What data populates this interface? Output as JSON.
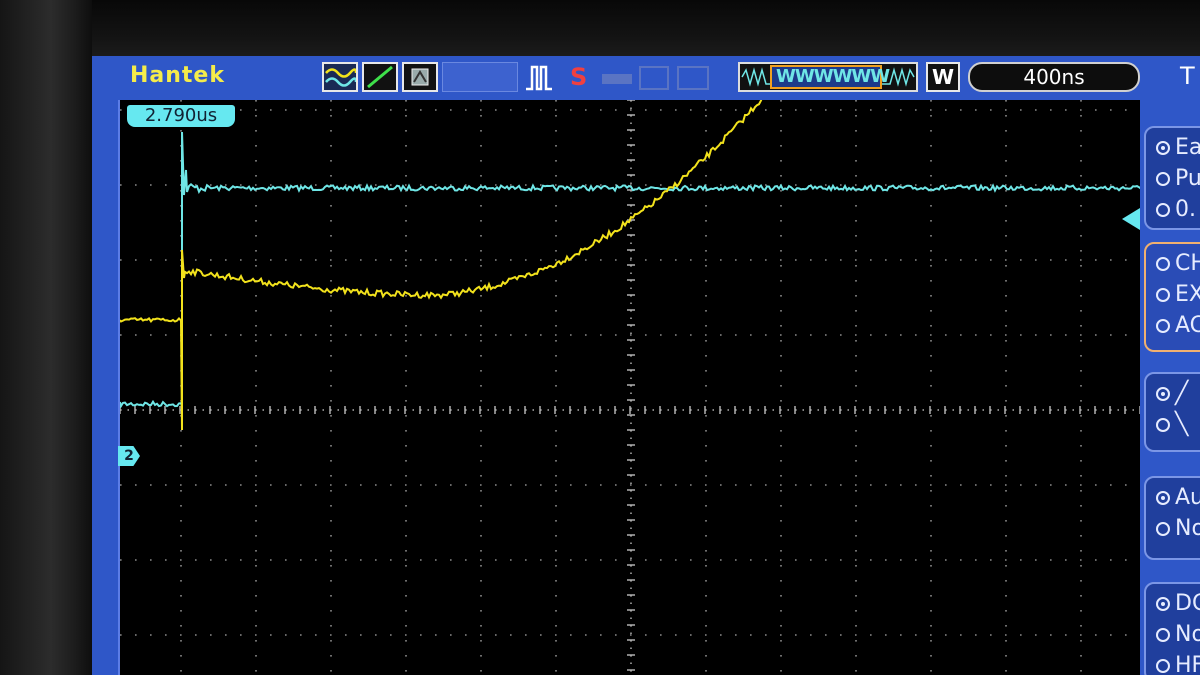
{
  "header": {
    "brand": "Hantek",
    "stop_indicator": "S",
    "memory_window_label": "WWWWWW",
    "window_mode": "W",
    "timebase": "400ns"
  },
  "cursor": {
    "time_readout": "2.790us"
  },
  "channel_marker": {
    "label": "2"
  },
  "side_panel": {
    "title": "T",
    "groups": [
      {
        "items": [
          {
            "label": "Ea",
            "selected": true
          },
          {
            "label": "Pu",
            "selected": false
          },
          {
            "label": "0.",
            "selected": false
          }
        ]
      },
      {
        "items": [
          {
            "label": "CH",
            "selected": false
          },
          {
            "label": "EX",
            "selected": false
          },
          {
            "label": "AC",
            "selected": false
          }
        ]
      },
      {
        "items": [
          {
            "label": "╱",
            "selected": true
          },
          {
            "label": "╲",
            "selected": false
          }
        ]
      },
      {
        "items": [
          {
            "label": "Au",
            "selected": true
          },
          {
            "label": "No",
            "selected": false
          }
        ]
      },
      {
        "items": [
          {
            "label": "DC",
            "selected": true
          },
          {
            "label": "No",
            "selected": false
          },
          {
            "label": "HF",
            "selected": false
          }
        ]
      }
    ]
  },
  "colors": {
    "ch1": "#f2e21c",
    "ch2": "#6fe6e6",
    "frame": "#2f57c8",
    "grid": "#8a8a8a"
  }
}
